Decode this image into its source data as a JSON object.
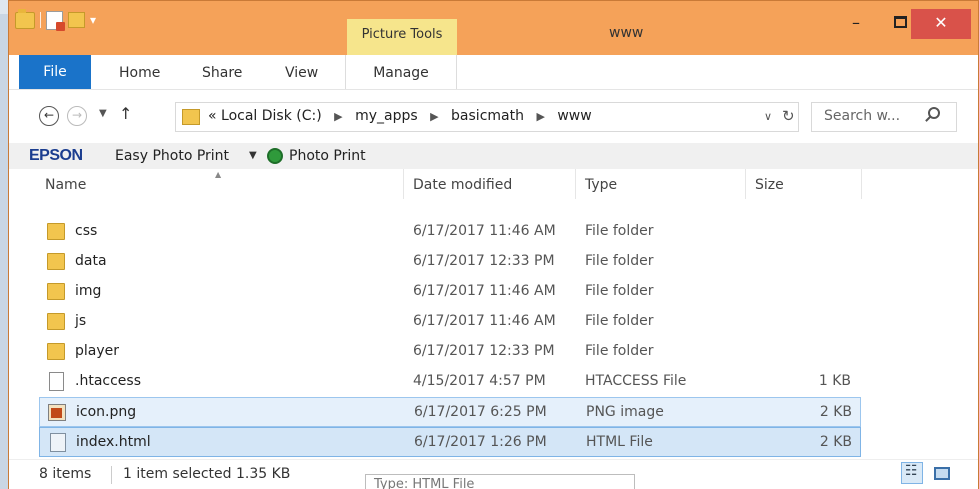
{
  "window": {
    "title": "www",
    "contextual_tab_group": "Picture Tools",
    "minimize_glyph": "–",
    "close_glyph": "✕"
  },
  "ribbon": {
    "tabs": [
      {
        "label": "File"
      },
      {
        "label": "Home"
      },
      {
        "label": "Share"
      },
      {
        "label": "View"
      },
      {
        "label": "Manage"
      }
    ],
    "help_glyph": "?"
  },
  "address": {
    "overflow": "«",
    "crumbs": [
      "Local Disk (C:)",
      "my_apps",
      "basicmath",
      "www"
    ],
    "search_placeholder": "Search w..."
  },
  "epson_toolbar": {
    "brand": "EPSON",
    "easy_photo_print": "Easy Photo Print",
    "photo_print": "Photo Print"
  },
  "columns": {
    "name": "Name",
    "date": "Date modified",
    "type": "Type",
    "size": "Size"
  },
  "files": [
    {
      "name": "css",
      "date": "6/17/2017 11:46 AM",
      "type": "File folder",
      "size": "",
      "icon": "folder-icon"
    },
    {
      "name": "data",
      "date": "6/17/2017 12:33 PM",
      "type": "File folder",
      "size": "",
      "icon": "folder-icon"
    },
    {
      "name": "img",
      "date": "6/17/2017 11:46 AM",
      "type": "File folder",
      "size": "",
      "icon": "folder-icon"
    },
    {
      "name": "js",
      "date": "6/17/2017 11:46 AM",
      "type": "File folder",
      "size": "",
      "icon": "folder-icon"
    },
    {
      "name": "player",
      "date": "6/17/2017 12:33 PM",
      "type": "File folder",
      "size": "",
      "icon": "folder-icon"
    },
    {
      "name": ".htaccess",
      "date": "4/15/2017 4:57 PM",
      "type": "HTACCESS File",
      "size": "1 KB",
      "icon": "file-icon"
    },
    {
      "name": "icon.png",
      "date": "6/17/2017 6:25 PM",
      "type": "PNG image",
      "size": "2 KB",
      "icon": "png-image-icon"
    },
    {
      "name": "index.html",
      "date": "6/17/2017 1:26 PM",
      "type": "HTML File",
      "size": "2 KB",
      "icon": "html-file-icon"
    }
  ],
  "status": {
    "item_count": "8 items",
    "selection": "1 item selected  1.35 KB",
    "tooltip": "Type: HTML File"
  },
  "colors": {
    "titlebar": "#f5a259",
    "file_tab": "#1a73c9",
    "picture_tools": "#f6e58c",
    "close_button": "#d9524a",
    "selection": "#d4e6f7"
  }
}
